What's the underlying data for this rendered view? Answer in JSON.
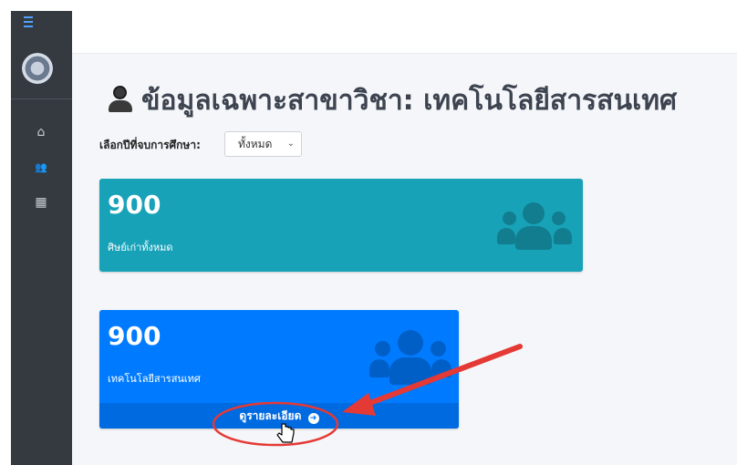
{
  "sidebar": {
    "menu_icon": "bars-icon",
    "logo": "university-logo",
    "items": [
      {
        "icon": "home-icon",
        "glyph": "⌂"
      },
      {
        "icon": "users-icon",
        "glyph": "👥"
      },
      {
        "icon": "calendar-icon",
        "glyph": "▦"
      }
    ]
  },
  "page": {
    "title": "ข้อมูลเฉพาะสาขาวิชา: เทคโนโลยีสารสนเทศ",
    "title_icon": "user-icon"
  },
  "filter": {
    "label": "เลือกปีที่จบการศึกษา:",
    "selected": "ทั้งหมด",
    "chevron": "⌄"
  },
  "cards": [
    {
      "count": "900",
      "label": "ศิษย์เก่าทั้งหมด",
      "icon": "users-icon",
      "color": "#17a2b8"
    },
    {
      "count": "900",
      "label": "เทคโนโลยีสารสนเทศ",
      "icon": "users-icon",
      "color": "#007bff",
      "footer": "ดูรายละเอียด",
      "footer_icon": "arrow-circle-right-icon",
      "footer_glyph": "➜"
    }
  ],
  "annotation": {
    "color": "#e53935"
  }
}
